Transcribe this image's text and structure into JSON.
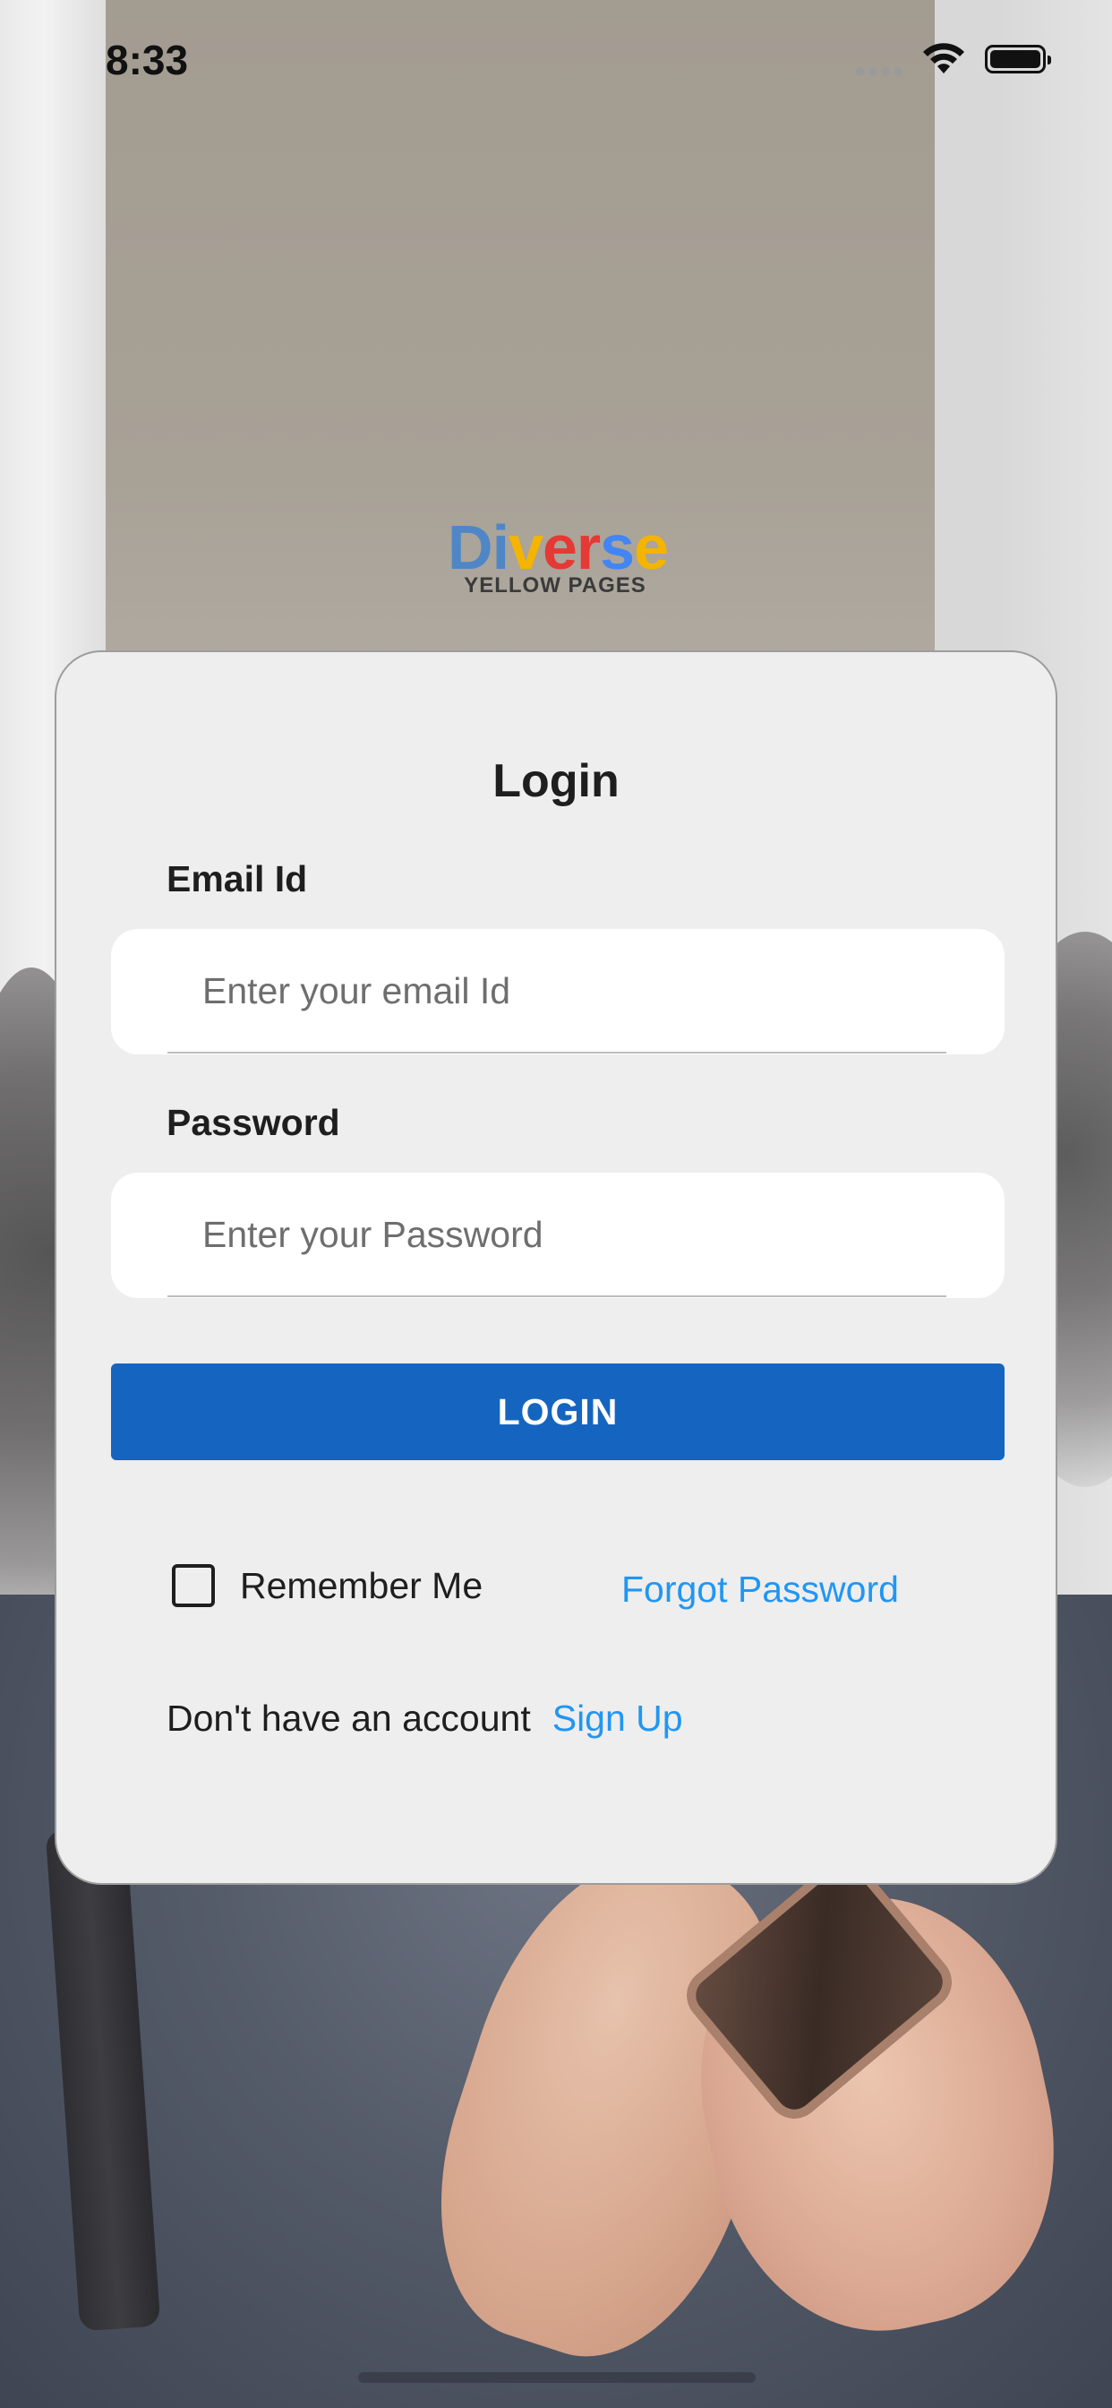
{
  "status_bar": {
    "time": "8:33"
  },
  "logo": {
    "letters": [
      {
        "char": "D",
        "color": "#4f86c6"
      },
      {
        "char": "i",
        "color": "#4f86c6"
      },
      {
        "char": "v",
        "color": "#f4b400"
      },
      {
        "char": "e",
        "color": "#e53935"
      },
      {
        "char": "r",
        "color": "#e53935"
      },
      {
        "char": "s",
        "color": "#4285f4"
      },
      {
        "char": "e",
        "color": "#f4b400"
      }
    ],
    "subtitle": "YELLOW PAGES"
  },
  "login_card": {
    "title": "Login",
    "email": {
      "label": "Email Id",
      "placeholder": "Enter your email Id",
      "value": ""
    },
    "password": {
      "label": "Password",
      "placeholder": "Enter your Password",
      "value": ""
    },
    "login_button": "LOGIN",
    "remember_me": {
      "label": "Remember Me",
      "checked": false
    },
    "forgot_password": "Forgot Password",
    "no_account_text": "Don't have an account",
    "sign_up": "Sign Up"
  },
  "colors": {
    "primary_button": "#1565c0",
    "link": "#2196f3",
    "card_background": "#eeeeee"
  }
}
